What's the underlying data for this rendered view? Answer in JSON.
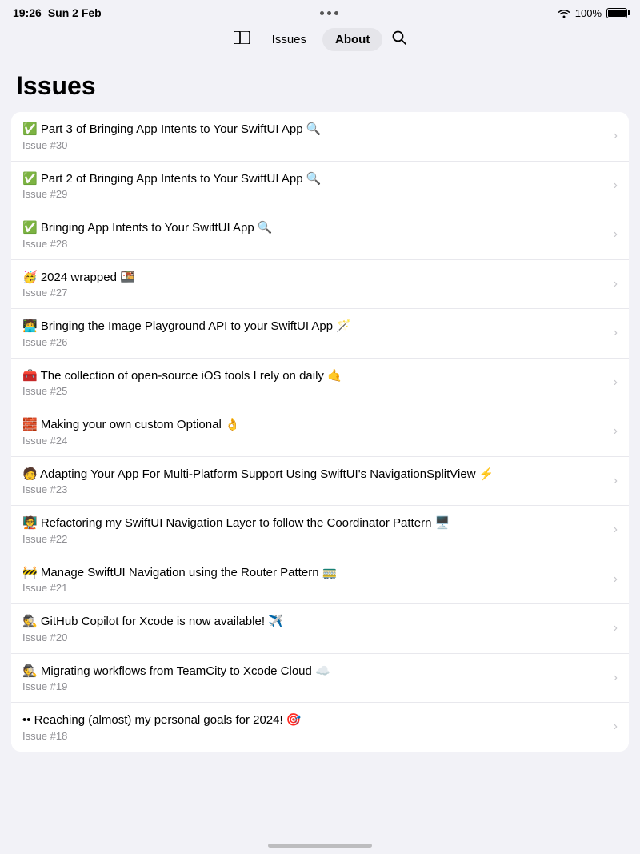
{
  "statusBar": {
    "time": "19:26",
    "date": "Sun 2 Feb",
    "battery": "100%"
  },
  "nav": {
    "sidebarLabel": "⊞",
    "issuesLabel": "Issues",
    "aboutLabel": "About",
    "searchLabel": "🔍"
  },
  "pageTitle": "Issues",
  "issues": [
    {
      "id": "issue-30",
      "title": "✅ Part 3 of Bringing App Intents to Your SwiftUI App 🔍",
      "number": "Issue #30"
    },
    {
      "id": "issue-29",
      "title": "✅ Part 2 of Bringing App Intents to Your SwiftUI App 🔍",
      "number": "Issue #29"
    },
    {
      "id": "issue-28",
      "title": "✅ Bringing App Intents to Your SwiftUI App 🔍",
      "number": "Issue #28"
    },
    {
      "id": "issue-27",
      "title": "🥳 2024 wrapped 🍱",
      "number": "Issue #27"
    },
    {
      "id": "issue-26",
      "title": "🧑‍💻 Bringing the Image Playground API to your SwiftUI App 🪄",
      "number": "Issue #26"
    },
    {
      "id": "issue-25",
      "title": "🧰 The collection of open-source iOS tools I rely on daily 🤙",
      "number": "Issue #25"
    },
    {
      "id": "issue-24",
      "title": "🧱 Making your own custom Optional 👌",
      "number": "Issue #24"
    },
    {
      "id": "issue-23",
      "title": "🧑 Adapting Your App For Multi-Platform Support Using SwiftUI's NavigationSplitView ⚡",
      "number": "Issue #23"
    },
    {
      "id": "issue-22",
      "title": "🧑‍🏫 Refactoring my SwiftUI Navigation Layer to follow the Coordinator Pattern 🖥️",
      "number": "Issue #22"
    },
    {
      "id": "issue-21",
      "title": "🚧 Manage SwiftUI Navigation using the Router Pattern 🚃",
      "number": "Issue #21"
    },
    {
      "id": "issue-20",
      "title": "🕵️ GitHub Copilot for Xcode is now available! ✈️",
      "number": "Issue #20"
    },
    {
      "id": "issue-19",
      "title": "🕵️ Migrating workflows from TeamCity to Xcode Cloud ☁️",
      "number": "Issue #19"
    },
    {
      "id": "issue-18",
      "title": "•• Reaching (almost) my personal goals for 2024! 🎯",
      "number": "Issue #18"
    }
  ]
}
